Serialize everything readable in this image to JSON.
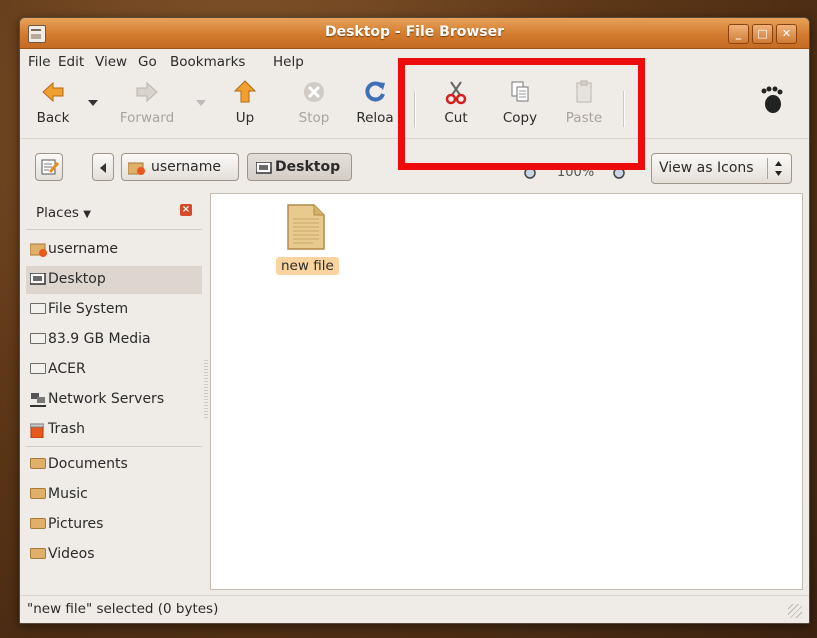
{
  "window": {
    "title": "Desktop - File Browser"
  },
  "menu": [
    "File",
    "Edit",
    "View",
    "Go",
    "Bookmarks",
    "Help"
  ],
  "toolbar": {
    "back": "Back",
    "forward": "Forward",
    "up": "Up",
    "stop": "Stop",
    "reload": "Reloa",
    "cut": "Cut",
    "copy": "Copy",
    "paste": "Paste"
  },
  "location": {
    "crumb_home": "username",
    "crumb_current": "Desktop",
    "zoom": "100%",
    "view_mode": "View as Icons"
  },
  "sidebar": {
    "header": "Places",
    "places": [
      {
        "label": "username",
        "icon": "home-folder-icon"
      },
      {
        "label": "Desktop",
        "icon": "desktop-icon",
        "selected": true
      },
      {
        "label": "File System",
        "icon": "drive-icon"
      },
      {
        "label": "83.9 GB Media",
        "icon": "drive-icon"
      },
      {
        "label": "ACER",
        "icon": "drive-icon"
      },
      {
        "label": "Network Servers",
        "icon": "network-icon"
      },
      {
        "label": "Trash",
        "icon": "trash-icon"
      }
    ],
    "bookmarks": [
      {
        "label": "Documents",
        "icon": "folder-icon"
      },
      {
        "label": "Music",
        "icon": "folder-icon"
      },
      {
        "label": "Pictures",
        "icon": "folder-icon"
      },
      {
        "label": "Videos",
        "icon": "folder-icon"
      }
    ]
  },
  "files": [
    {
      "name": "new file",
      "icon": "text-file-icon",
      "selected": true
    }
  ],
  "status": "\"new file\" selected (0 bytes)",
  "colors": {
    "accent": "#d27b2e",
    "highlight": "#ee0b0b",
    "selection": "#f9d49e"
  }
}
